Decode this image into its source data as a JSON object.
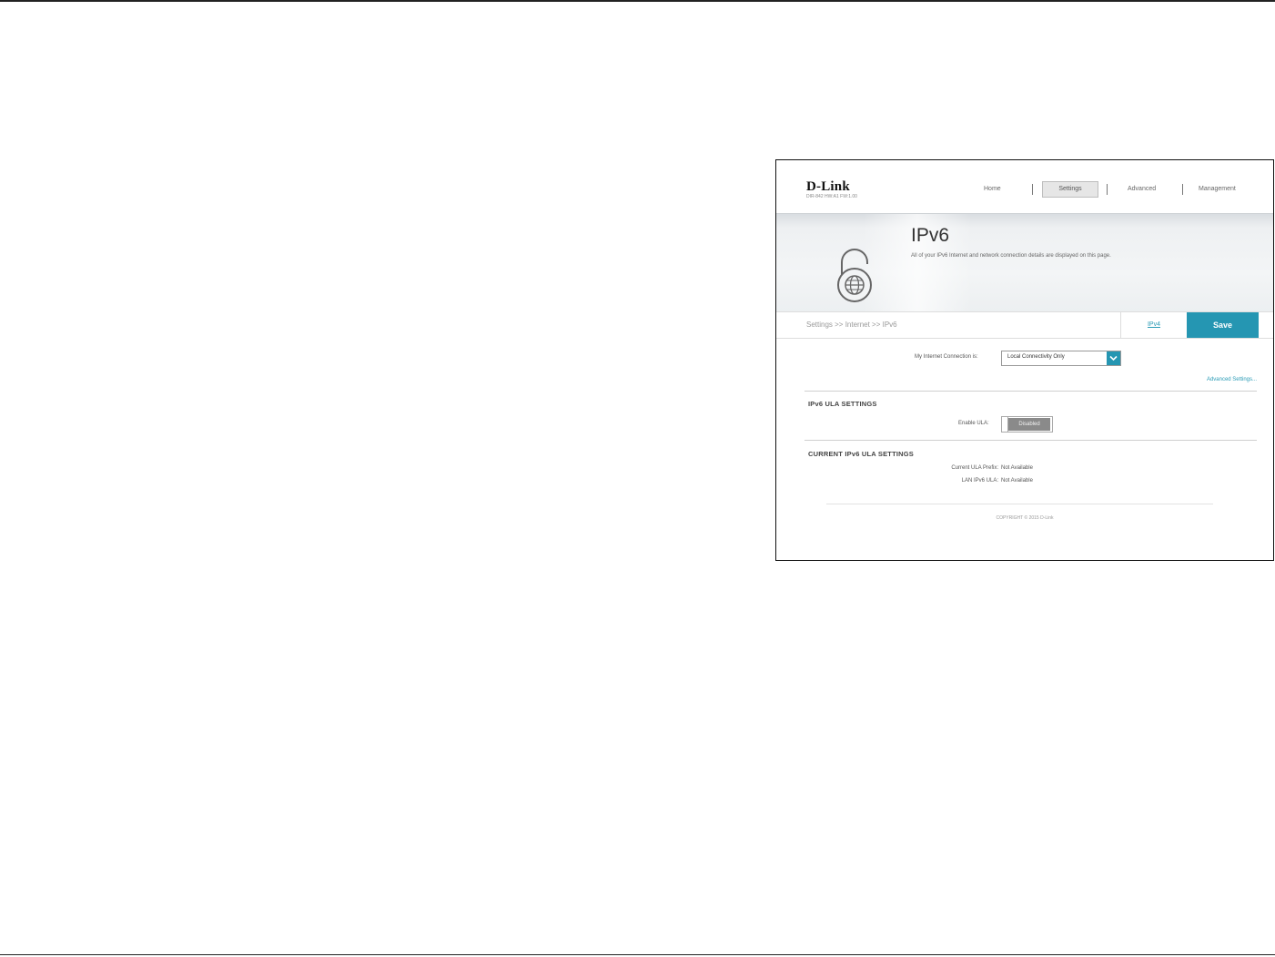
{
  "header": {
    "logo": "D-Link",
    "model_line": "DIR-842  HW:A1  FW:1.00",
    "nav": [
      "Home",
      "Settings",
      "Advanced",
      "Management"
    ],
    "active_nav": "Settings"
  },
  "hero": {
    "title": "IPv6",
    "description": "All of your IPv6 Internet and network connection details are displayed on this page."
  },
  "crumbbar": {
    "breadcrumb": "Settings >> Internet >> IPv6",
    "ipv4_link": "IPv4",
    "save_label": "Save"
  },
  "connection": {
    "label": "My Internet Connection is:",
    "selected": "Local Connectivity Only"
  },
  "advanced_link": "Advanced Settings...",
  "ula_settings": {
    "title": "IPv6 ULA SETTINGS",
    "enable_label": "Enable ULA:",
    "enable_state": "Disabled"
  },
  "current_ula": {
    "title": "CURRENT IPv6 ULA SETTINGS",
    "rows": [
      {
        "label": "Current ULA Prefix:",
        "value": "Not Available"
      },
      {
        "label": "LAN IPv6 ULA:",
        "value": "Not Available"
      }
    ]
  },
  "footer": {
    "copyright": "COPYRIGHT © 2015 D-Link"
  },
  "colors": {
    "accent": "#2596b2",
    "toggle_off": "#8a8a8a"
  }
}
